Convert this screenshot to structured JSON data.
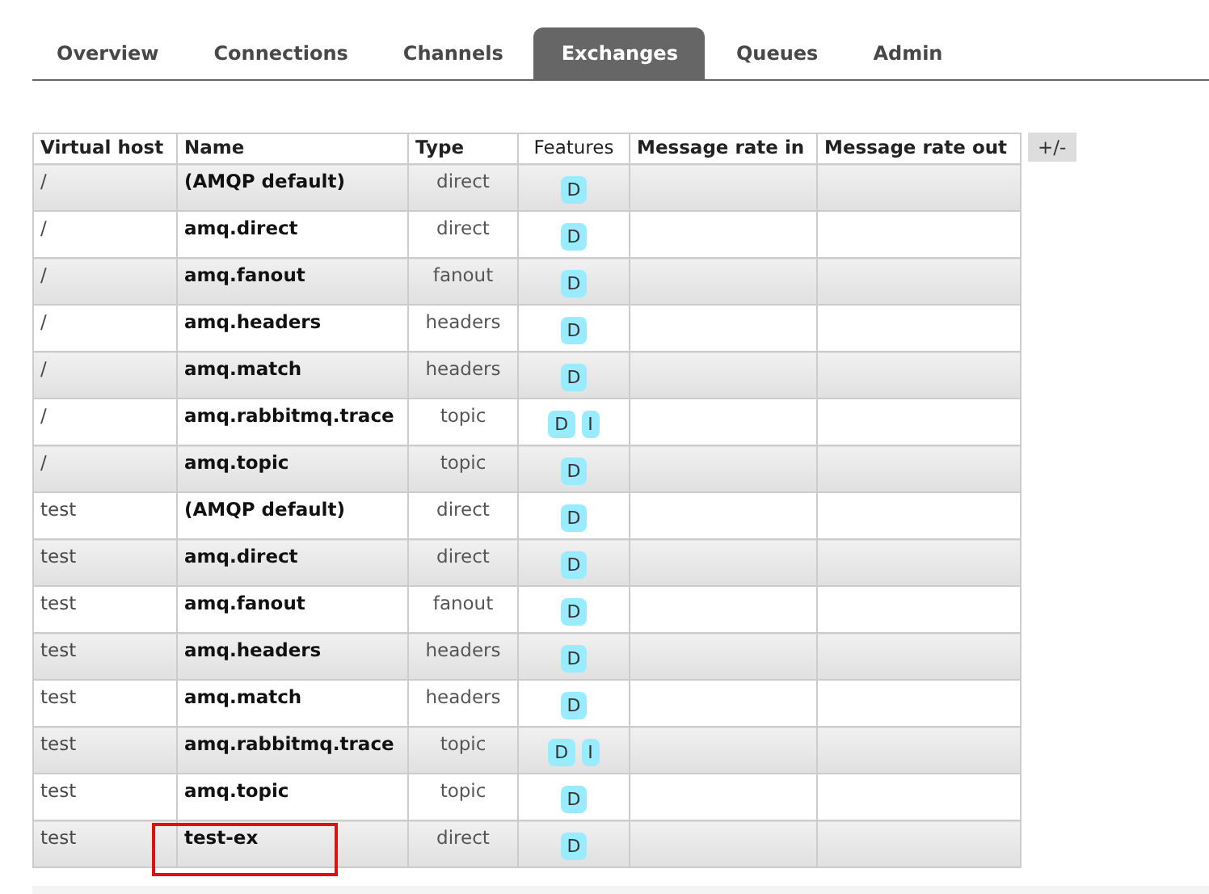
{
  "tabs": [
    {
      "label": "Overview",
      "selected": false
    },
    {
      "label": "Connections",
      "selected": false
    },
    {
      "label": "Channels",
      "selected": false
    },
    {
      "label": "Exchanges",
      "selected": true
    },
    {
      "label": "Queues",
      "selected": false
    },
    {
      "label": "Admin",
      "selected": false
    }
  ],
  "table": {
    "columns": [
      "Virtual host",
      "Name",
      "Type",
      "Features",
      "Message rate in",
      "Message rate out"
    ],
    "toggle": "+/-",
    "rows": [
      {
        "vhost": "/",
        "name": "(AMQP default)",
        "type": "direct",
        "features": [
          "D"
        ],
        "highlighted": false
      },
      {
        "vhost": "/",
        "name": "amq.direct",
        "type": "direct",
        "features": [
          "D"
        ],
        "highlighted": false
      },
      {
        "vhost": "/",
        "name": "amq.fanout",
        "type": "fanout",
        "features": [
          "D"
        ],
        "highlighted": false
      },
      {
        "vhost": "/",
        "name": "amq.headers",
        "type": "headers",
        "features": [
          "D"
        ],
        "highlighted": false
      },
      {
        "vhost": "/",
        "name": "amq.match",
        "type": "headers",
        "features": [
          "D"
        ],
        "highlighted": false
      },
      {
        "vhost": "/",
        "name": "amq.rabbitmq.trace",
        "type": "topic",
        "features": [
          "D",
          "I"
        ],
        "highlighted": false
      },
      {
        "vhost": "/",
        "name": "amq.topic",
        "type": "topic",
        "features": [
          "D"
        ],
        "highlighted": false
      },
      {
        "vhost": "test",
        "name": "(AMQP default)",
        "type": "direct",
        "features": [
          "D"
        ],
        "highlighted": false
      },
      {
        "vhost": "test",
        "name": "amq.direct",
        "type": "direct",
        "features": [
          "D"
        ],
        "highlighted": false
      },
      {
        "vhost": "test",
        "name": "amq.fanout",
        "type": "fanout",
        "features": [
          "D"
        ],
        "highlighted": false
      },
      {
        "vhost": "test",
        "name": "amq.headers",
        "type": "headers",
        "features": [
          "D"
        ],
        "highlighted": false
      },
      {
        "vhost": "test",
        "name": "amq.match",
        "type": "headers",
        "features": [
          "D"
        ],
        "highlighted": false
      },
      {
        "vhost": "test",
        "name": "amq.rabbitmq.trace",
        "type": "topic",
        "features": [
          "D",
          "I"
        ],
        "highlighted": false
      },
      {
        "vhost": "test",
        "name": "amq.topic",
        "type": "topic",
        "features": [
          "D"
        ],
        "highlighted": false
      },
      {
        "vhost": "test",
        "name": "test-ex",
        "type": "direct",
        "features": [
          "D"
        ],
        "highlighted": true
      }
    ]
  }
}
